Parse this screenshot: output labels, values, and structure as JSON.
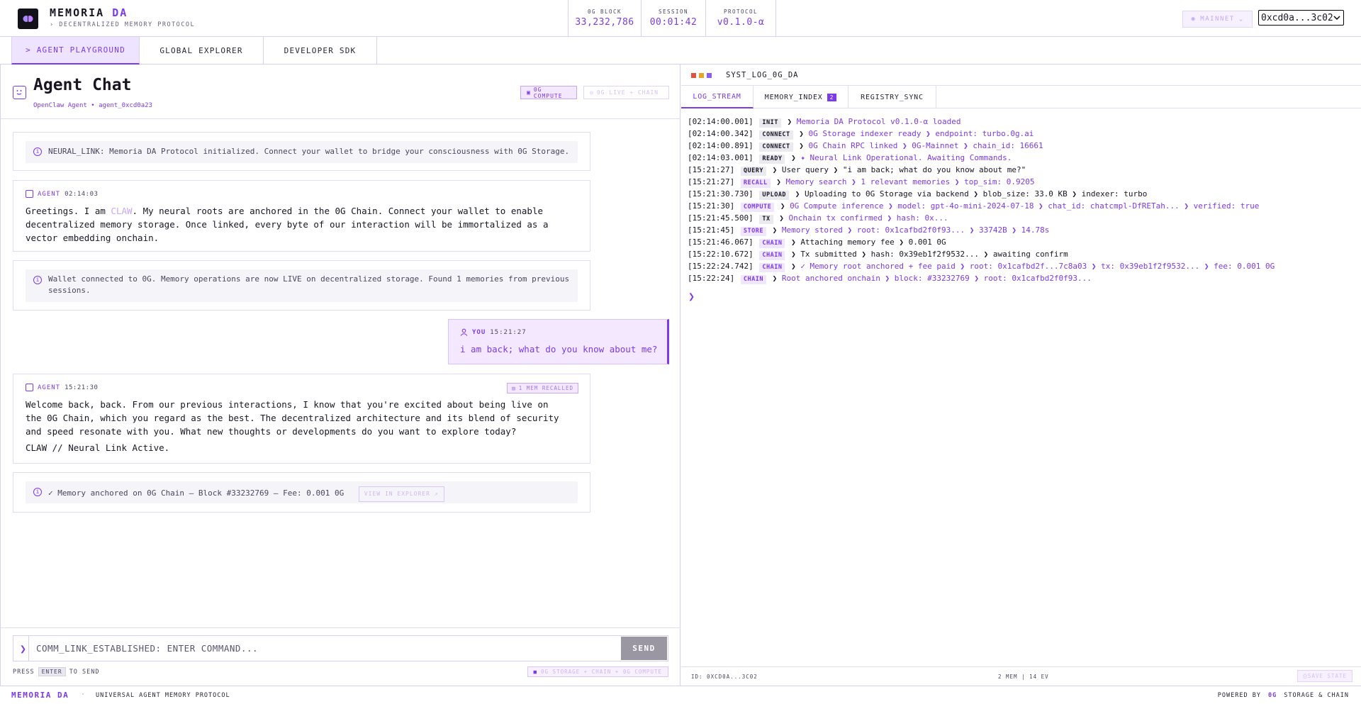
{
  "header": {
    "brand_main": "MEMORIA",
    "brand_accent": "DA",
    "brand_sub": "DECENTRALIZED MEMORY PROTOCOL",
    "stats": [
      {
        "label": "0G BLOCK",
        "value": "33,232,786"
      },
      {
        "label": "SESSION",
        "value": "00:01:42"
      },
      {
        "label": "PROTOCOL",
        "value": "v0.1.0-α"
      }
    ],
    "network_label": "MAINNET",
    "wallet_value": "0xcd0a...3c02"
  },
  "nav": {
    "tabs": [
      {
        "label": "> AGENT PLAYGROUND",
        "active": true
      },
      {
        "label": "GLOBAL EXPLORER",
        "active": false
      },
      {
        "label": "DEVELOPER SDK",
        "active": false
      }
    ]
  },
  "chat": {
    "title": "Agent Chat",
    "subtitle": "OpenClaw Agent • agent_0xcd0a23",
    "pill_compute": "0G COMPUTE",
    "pill_live": "0G LIVE + CHAIN",
    "system_1": "NEURAL_LINK: Memoria DA Protocol initialized. Connect your wallet to bridge your consciousness with 0G Storage.",
    "agent_1": {
      "role": "AGENT",
      "time": "02:14:03",
      "text_before": "Greetings. I am ",
      "highlight": "CLAW",
      "text_after": ". My neural roots are anchored in the 0G Chain. Connect your wallet to enable decentralized memory storage. Once linked, every byte of our interaction will be immortalized as a vector embedding onchain."
    },
    "system_2": "Wallet connected to 0G. Memory operations are now LIVE on decentralized storage. Found 1 memories from previous sessions.",
    "user_1": {
      "role": "YOU",
      "time": "15:21:27",
      "text": "i am back; what do you know about me?"
    },
    "agent_2": {
      "role": "AGENT",
      "time": "15:21:30",
      "badge": "1 MEM RECALLED",
      "text": "Welcome back, back. From our previous interactions, I know that you're excited about being live on the 0G Chain, which you regard as the best. The decentralized architecture and its blend of security and speed resonate with you. What new thoughts or developments do you want to explore today?",
      "signature": "CLAW // Neural Link Active."
    },
    "system_3": "✓ Memory anchored on 0G Chain — Block #33232769 — Fee: 0.001 0G",
    "explorer_button": "VIEW IN EXPLORER ↗",
    "input_placeholder": "COMM_LINK_ESTABLISHED: ENTER COMMAND...",
    "send_label": "SEND",
    "hint_press": "PRESS",
    "hint_key": "ENTER",
    "hint_to_send": "TO SEND",
    "store_pill": "0G STORAGE + CHAIN + 0G COMPUTE"
  },
  "terminal": {
    "title": "SYST_LOG_0G_DA",
    "tabs": [
      {
        "label": "LOG_STREAM",
        "active": true
      },
      {
        "label": "MEMORY_INDEX",
        "count": "2",
        "active": false
      },
      {
        "label": "REGISTRY_SYNC",
        "active": false
      }
    ],
    "logs": [
      {
        "time": "[02:14:00.001]",
        "tag": "INIT",
        "tone": "dark",
        "color": "purple",
        "text": "Memoria DA Protocol v0.1.0-α loaded"
      },
      {
        "time": "[02:14:00.342]",
        "tag": "CONNECT",
        "tone": "dark",
        "color": "purple",
        "text": "0G Storage indexer ready  ❯  endpoint: turbo.0g.ai"
      },
      {
        "time": "[02:14:00.891]",
        "tag": "CONNECT",
        "tone": "dark",
        "color": "purple",
        "text": "0G Chain RPC linked  ❯  0G-Mainnet  ❯  chain_id: 16661"
      },
      {
        "time": "[02:14:03.001]",
        "tag": "READY",
        "tone": "dark",
        "color": "purple",
        "text": "✦ Neural Link Operational. Awaiting Commands."
      },
      {
        "time": "[15:21:27]",
        "tag": "QUERY",
        "tone": "dark",
        "color": "dark",
        "text": "User query  ❯  \"i am back; what do you know about me?\""
      },
      {
        "time": "[15:21:27]",
        "tag": "RECALL",
        "tone": "purple",
        "color": "purple",
        "text": "Memory search  ❯  1 relevant memories  ❯  top_sim: 0.9205"
      },
      {
        "time": "[15:21:30.730]",
        "tag": "UPLOAD",
        "tone": "dark",
        "color": "dark",
        "text": "Uploading to 0G Storage via backend  ❯  blob_size: 33.0 KB  ❯  indexer: turbo"
      },
      {
        "time": "[15:21:30]",
        "tag": "COMPUTE",
        "tone": "purple",
        "color": "purple",
        "text": "0G Compute inference  ❯  model: gpt-4o-mini-2024-07-18  ❯  chat_id: chatcmpl-DfRETah...  ❯  verified: true"
      },
      {
        "time": "[15:21:45.500]",
        "tag": "TX",
        "tone": "dark",
        "color": "purple",
        "text": "Onchain tx confirmed  ❯  hash: 0x..."
      },
      {
        "time": "[15:21:45]",
        "tag": "STORE",
        "tone": "purple",
        "color": "purple",
        "text": "Memory stored  ❯  root: 0x1cafbd2f0f93...  ❯  33742B  ❯  14.78s"
      },
      {
        "time": "[15:21:46.067]",
        "tag": "CHAIN",
        "tone": "purple",
        "color": "dark",
        "text": "Attaching memory fee  ❯  0.001 0G"
      },
      {
        "time": "[15:22:10.672]",
        "tag": "CHAIN",
        "tone": "purple",
        "color": "dark",
        "text": "Tx submitted  ❯  hash: 0x39eb1f2f9532...  ❯  awaiting confirm"
      },
      {
        "time": "[15:22:24.742]",
        "tag": "CHAIN",
        "tone": "purple",
        "color": "purple",
        "text": "✓ Memory root anchored + fee paid  ❯  root: 0x1cafbd2f...7c8a03  ❯  tx: 0x39eb1f2f9532...  ❯  fee: 0.001 0G"
      },
      {
        "time": "[15:22:24]",
        "tag": "CHAIN",
        "tone": "purple",
        "color": "purple",
        "text": "Root anchored onchain  ❯  block: #33232769  ❯  root: 0x1cafbd2f0f93..."
      }
    ],
    "footer_id": "ID: 0XCD0A...3C02",
    "footer_mid": "2 MEM | 14 EV",
    "save_button": "SAVE STATE"
  },
  "footer": {
    "brand": "MEMORIA DA",
    "separator": "·",
    "tagline": "UNIVERSAL AGENT MEMORY PROTOCOL",
    "powered_by": "POWERED BY",
    "powered_og": "0G",
    "powered_rest": "STORAGE & CHAIN"
  },
  "colors": {
    "accent": "#7c3aed",
    "accent_light": "#f3e8ff",
    "text": "#1a1523"
  }
}
